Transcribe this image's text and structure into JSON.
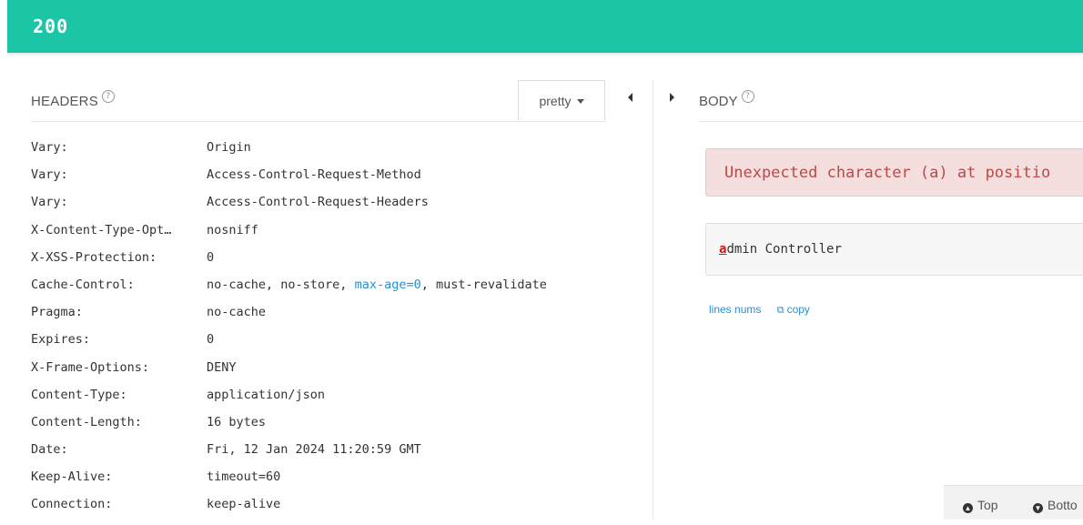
{
  "status": {
    "code": "200",
    "color": "#1bc5a6"
  },
  "headers_panel": {
    "title": "HEADERS",
    "help_icon": "question-circle-icon",
    "format_button": "pretty",
    "rows": [
      {
        "name": "Vary:",
        "value": "Origin"
      },
      {
        "name": "Vary:",
        "value": "Access-Control-Request-Method"
      },
      {
        "name": "Vary:",
        "value": "Access-Control-Request-Headers"
      },
      {
        "name": "X-Content-Type-Opt…",
        "value": "nosniff"
      },
      {
        "name": "X-XSS-Protection:",
        "value": "0"
      },
      {
        "name": "Cache-Control:",
        "value_parts": [
          "no-cache, no-store, ",
          "max-age=0",
          ", must-revalidate"
        ]
      },
      {
        "name": "Pragma:",
        "value": "no-cache"
      },
      {
        "name": "Expires:",
        "value": "0"
      },
      {
        "name": "X-Frame-Options:",
        "value": "DENY"
      },
      {
        "name": "Content-Type:",
        "value": "application/json"
      },
      {
        "name": "Content-Length:",
        "value": "16 bytes"
      },
      {
        "name": "Date:",
        "value": "Fri, 12 Jan 2024 11:20:59 GMT"
      },
      {
        "name": "Keep-Alive:",
        "value": "timeout=60"
      },
      {
        "name": "Connection:",
        "value": "keep-alive"
      }
    ]
  },
  "body_panel": {
    "title": "BODY",
    "help_icon": "question-circle-icon",
    "error_message": "Unexpected character (a) at positio",
    "content_first_char": "a",
    "content_rest": "dmin Controller",
    "lines_nums_label": "lines nums",
    "copy_label": "copy"
  },
  "footer_nav": {
    "top_label": "Top",
    "bottom_label": "Botto"
  }
}
